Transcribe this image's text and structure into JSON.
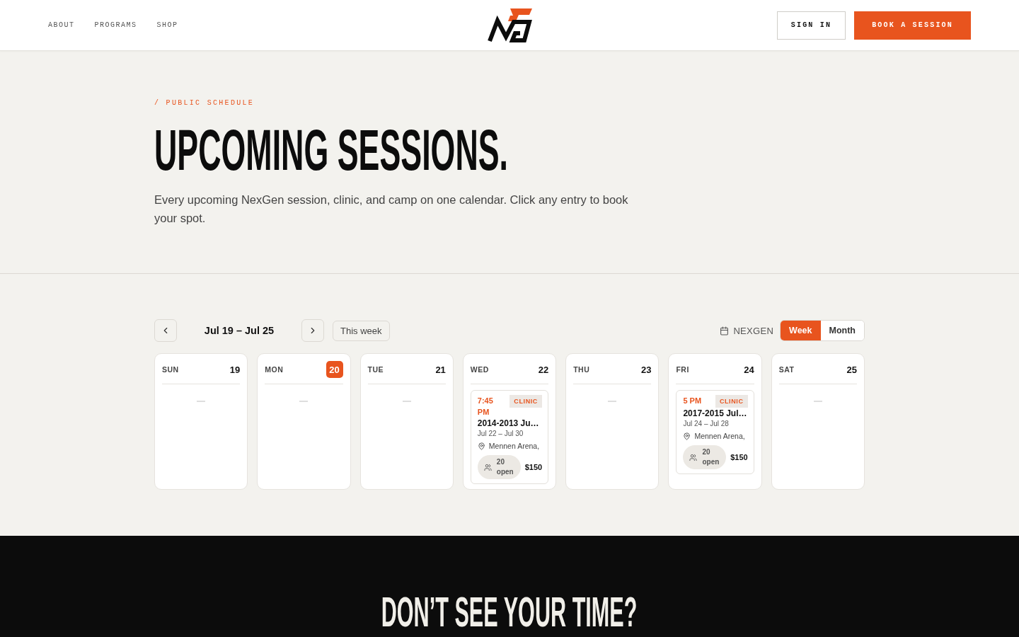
{
  "header": {
    "nav": [
      "ABOUT",
      "PROGRAMS",
      "SHOP"
    ],
    "buttons": [
      {
        "label": "SIGN IN",
        "kind": "outline"
      },
      {
        "label": "BOOK A SESSION",
        "kind": "primary"
      }
    ]
  },
  "hero": {
    "eyebrow": "/ PUBLIC SCHEDULE",
    "title": "UPCOMING SESSIONS.",
    "intro": "Every upcoming NexGen session, clinic, and camp on one calendar. Click any entry to book your spot."
  },
  "calendar": {
    "range": "Jul 19 – Jul 25",
    "today_button": "This week",
    "source": "NEXGEN",
    "views": [
      {
        "label": "Week",
        "selected": true
      },
      {
        "label": "Month",
        "selected": false
      }
    ],
    "days": [
      {
        "name": "SUN",
        "date": "19",
        "today": false
      },
      {
        "name": "MON",
        "date": "20",
        "today": true
      },
      {
        "name": "TUE",
        "date": "21",
        "today": false
      },
      {
        "name": "WED",
        "date": "22",
        "today": false,
        "events": [
          {
            "time": "7:45 PM",
            "tag": "CLINIC",
            "title": "2014-2013 Ju…",
            "dates": "Jul 22 – Jul 30",
            "location": "Mennen Arena,",
            "spots": "20 open",
            "price": "$150"
          }
        ]
      },
      {
        "name": "THU",
        "date": "23",
        "today": false
      },
      {
        "name": "FRI",
        "date": "24",
        "today": false,
        "events": [
          {
            "time": "5 PM",
            "tag": "CLINIC",
            "title": "2017-2015 Jul…",
            "dates": "Jul 24 – Jul 28",
            "location": "Mennen Arena,",
            "spots": "20 open",
            "price": "$150"
          }
        ]
      },
      {
        "name": "SAT",
        "date": "25",
        "today": false
      }
    ]
  },
  "cta": {
    "title": "DON’T SEE YOUR TIME?"
  }
}
